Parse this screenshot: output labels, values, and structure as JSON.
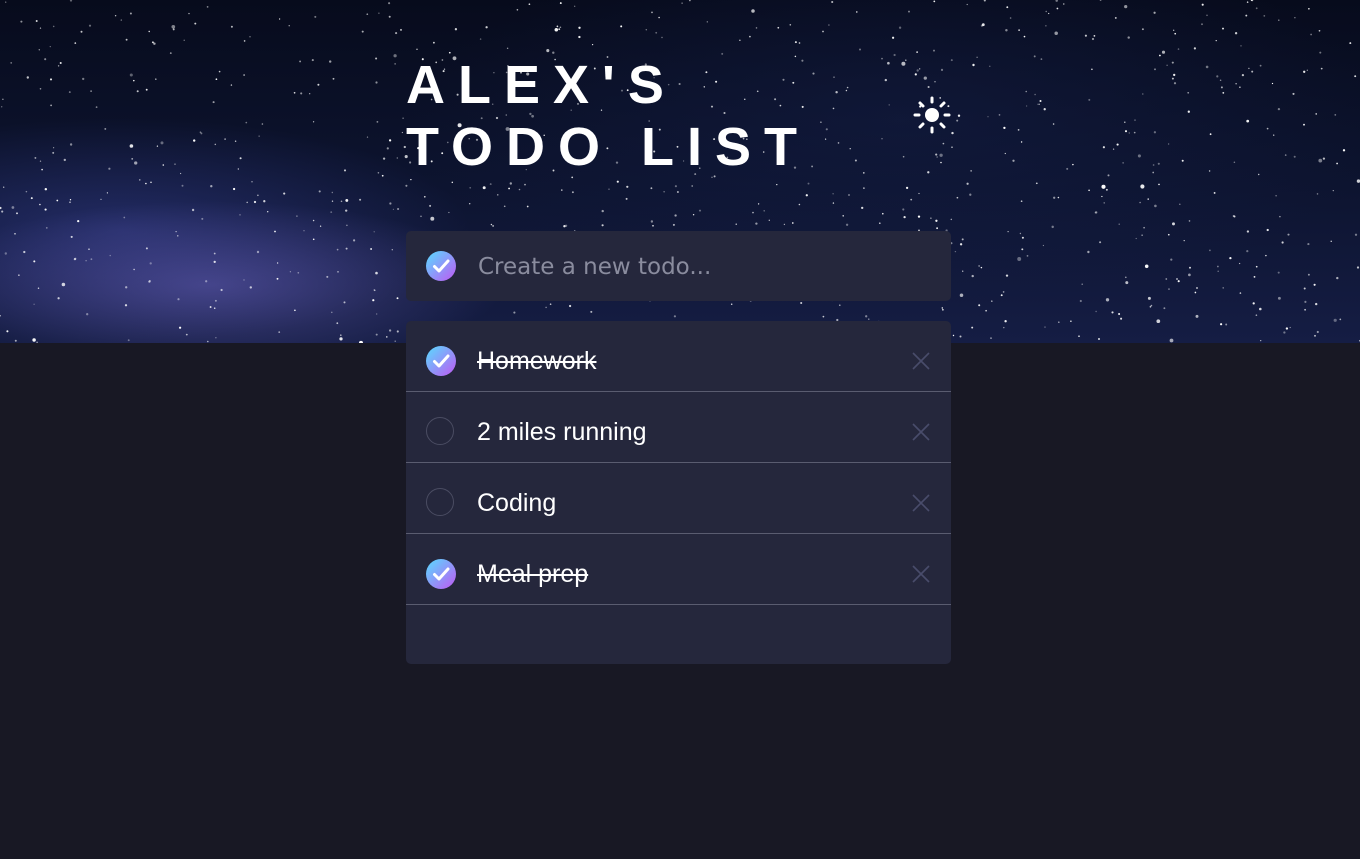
{
  "app": {
    "title_line1": "ALEX'S",
    "title_line2": "TODO LIST",
    "theme_icon": "sun-icon"
  },
  "new_todo": {
    "placeholder": "Create a new todo...",
    "value": ""
  },
  "todos": [
    {
      "label": "Homework",
      "completed": true
    },
    {
      "label": "2 miles running",
      "completed": false
    },
    {
      "label": "Coding",
      "completed": false
    },
    {
      "label": "Meal prep",
      "completed": true
    }
  ],
  "colors": {
    "page_background": "#181824",
    "card_background": "#25273c",
    "check_gradient_start": "#57ddff",
    "check_gradient_end": "#c058f3",
    "text": "#ffffff",
    "divider": "#5a5c70",
    "delete_icon": "#494c6b"
  }
}
